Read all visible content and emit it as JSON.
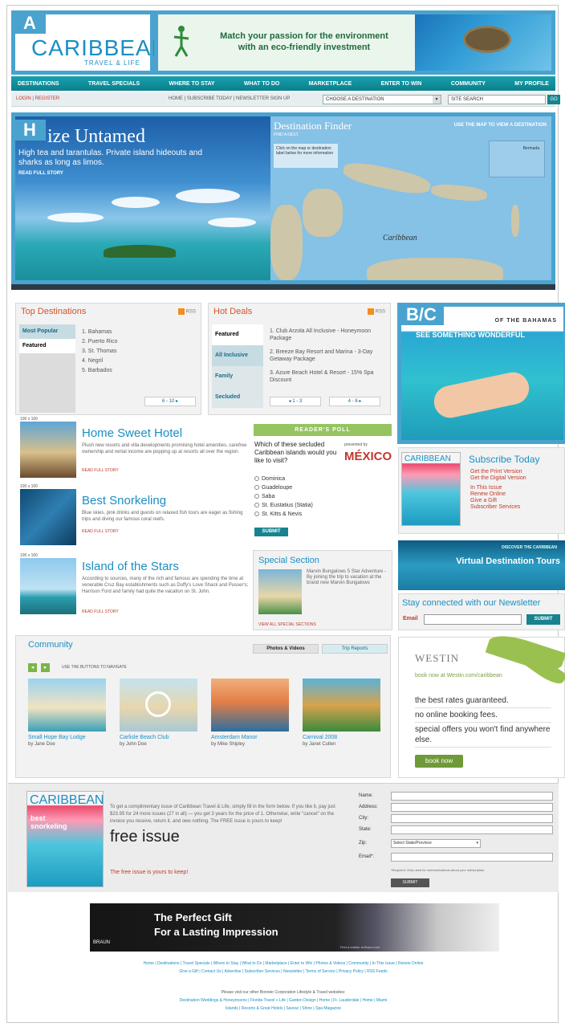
{
  "annotations": {
    "a": "A",
    "h": "H",
    "bc": "B/C"
  },
  "logo": {
    "main": "CARIBBEAN",
    "sub": "TRAVEL & LIFE"
  },
  "top_ad": {
    "line1": "Match your passion for the environment",
    "line2": "with an eco-friendly investment"
  },
  "nav": [
    "DESTINATIONS",
    "TRAVEL SPECIALS",
    "WHERE TO STAY",
    "WHAT TO DO",
    "MARKETPLACE",
    "ENTER TO WIN",
    "COMMUNITY",
    "MY PROFILE"
  ],
  "subbar": {
    "login": "LOGIN | REGISTER",
    "utility": "HOME | SUBSCRIBE TODAY | NEWSLETTER SIGN UP",
    "destination_select": "CHOOSE A DESTINATION",
    "site_search": "SITE SEARCH",
    "go": "GO"
  },
  "hero": {
    "title": "ize Untamed",
    "desc": "High tea and tarantulas. Private island hideouts and sharks as long as limos.",
    "read": "READ FULL STORY",
    "finder_title": "Destination Finder",
    "finder_sub": "FIND A DEST.",
    "finder_hint": "USE THE MAP TO VIEW A DESTINATION",
    "finder_note": "Click on the map or destination label below for more information",
    "map_label": "Caribbean",
    "inset_label": "Bermuda"
  },
  "top_destinations": {
    "title": "Top Destinations",
    "rss": "RSS",
    "tabs": [
      "Most Popular",
      "Featured"
    ],
    "items": [
      "1. Bahamas",
      "2. Puerto Rico",
      "3. St. Thomas",
      "4. Negril",
      "5. Barbados"
    ],
    "pager": "6 - 10 ▸"
  },
  "hot_deals": {
    "title": "Hot Deals",
    "rss": "RSS",
    "tabs": [
      "Featured",
      "All Inclusive",
      "Family",
      "Secluded"
    ],
    "items": [
      "1. Club Arzola All Inclusive - Honeymoon Package",
      "2. Breeze Bay Resort and Marina - 3-Day Getaway Package",
      "3. Azure Beach Hotel & Resort - 15% Spa Discount"
    ],
    "pager_prev": "◂ 1 - 3",
    "pager_next": "4 - 6 ▸"
  },
  "bahamas_ad": {
    "line1": "OF THE BAHAMAS",
    "line2": "SEE SOMETHING WONDERFUL"
  },
  "articles": [
    {
      "size": "100 x 100",
      "title": "Home Sweet Hotel",
      "text": "Plush new resorts and villa developments promising hotel amenities, carefree ownership and rental income are popping up at resorts all over the region.",
      "read": "READ FULL STORY"
    },
    {
      "size": "100 x 100",
      "title": "Best Snorkeling",
      "text": "Blue skies, pink drinks and guests on relaxed fish tours are eager as fishing trips and diving our famous coral reefs.",
      "read": "READ FULL STORY"
    },
    {
      "size": "100 x 100",
      "title": "Island of the Stars",
      "text": "According to sources, many of the rich and famous are spending the time at venerable Cruz Bay establishments such as Duffy's Love Shack and Pusser's; Harrison Ford and family had quite the vacation on St. John.",
      "read": "READ FULL STORY"
    }
  ],
  "poll": {
    "header": "READER'S POLL",
    "question": "Which of these secluded Caribbean islands would you like to visit?",
    "presented": "presented by",
    "sponsor": "MÉXICO",
    "options": [
      "Dominica",
      "Guadeloupe",
      "Saba",
      "St. Eustatius (Statia)",
      "St. Kitts & Nevis"
    ],
    "submit": "SUBMIT"
  },
  "special": {
    "title": "Special Section",
    "text": "Marvin Bungalows 5 Star Adventure - By joining the trip to vacation at the brand new Marvin Bungalows",
    "link": "VIEW ALL SPECIAL SECTIONS"
  },
  "subscribe": {
    "mag_title": "CARIBBEAN",
    "title": "Subscribe Today",
    "links": [
      "Get the Print Version",
      "Get the Digital Version",
      "In This Issue",
      "Renew Online",
      "Give a Gift",
      "Subscriber Services"
    ]
  },
  "vdt": {
    "line1": "DISCOVER THE CARIBBEAN",
    "line2": "Virtual Destination Tours"
  },
  "newsletter": {
    "title": "Stay connected with our Newsletter",
    "email_label": "Email",
    "submit": "SUBMIT"
  },
  "westin": {
    "brand": "WESTIN",
    "book": "book now at Westin.com/caribbean",
    "perks": [
      "the best rates guaranteed.",
      "no online booking fees.",
      "special offers you won't find anywhere else."
    ],
    "cta": "book now"
  },
  "community": {
    "title": "Community",
    "tabs": [
      "Photos & Videos",
      "Trip Reports"
    ],
    "hint": "USE THE BUTTONS TO NAVIGATE",
    "items": [
      {
        "caption": "Small Hope Bay Lodge",
        "by": "by Jane Doe"
      },
      {
        "caption": "Carlisle Beach Club",
        "by": "by John Doe"
      },
      {
        "caption": "Amsterdam Manor",
        "by": "by Mike Shipley"
      },
      {
        "caption": "Carnival 2008",
        "by": "by Janet Cullen"
      }
    ]
  },
  "free_issue": {
    "mag_title": "CARIBBEAN",
    "mag_cover": "best snorkeling",
    "text": "To get a complimentary issue of Caribbean Travel & Life, simply fill in the form below. If you like it, pay just $23.95 for 24 more issues (27 in all) — you get 3 years for the price of 1. Otherwise, write \"cancel\" on the invoice you receive, return it, and owe nothing. The FREE issue is yours to keep!",
    "big": "free issue",
    "link": "The free issue is yours to keep!",
    "labels": [
      "Name:",
      "Address:",
      "City:",
      "State:",
      "Zip:",
      "Email*:"
    ],
    "state_placeholder": "Select State/Province",
    "note": "*Required. Only used for communications about your subscription.",
    "submit": "SUBMIT"
  },
  "gift_banner": {
    "line1": "The Perfect Gift",
    "line2": "For a Lasting Impression",
    "brand": "BRAUN",
    "small": "Find a retailer at Braun.com"
  },
  "footer": {
    "links1": "Home | Destinations | Travel Specials | Where to Stay | What to Do | Marketplace | Enter to Win | Photos & Videos | Community | In This Issue | Renew Online",
    "links2": "Give a Gift | Contact Us | Advertise | Subscriber Services | Newsletter | Terms of Service | Privacy Policy | RSS Feeds",
    "note": "Please visit our other Bonnier Corporation Lifestyle & Travel websites:",
    "links3": "Destination Weddings & Honeymoons | Florida Travel + Life | Garden Design | Home | Ft. Lauderdale | Home | Miami",
    "links4": "Islands | Resorts & Great Hotels | Saveur | Shine | Spa Magazine"
  }
}
